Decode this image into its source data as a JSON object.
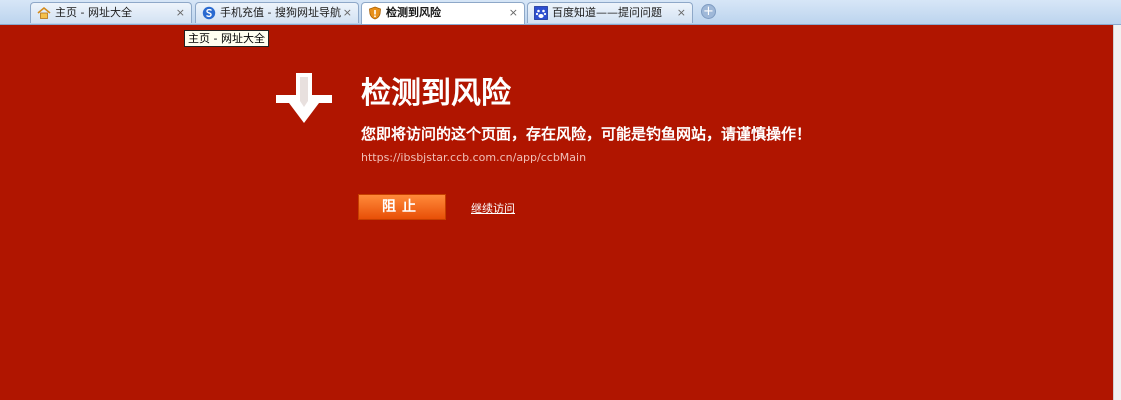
{
  "tabs": [
    {
      "label": "主页 - 网址大全",
      "icon": "home-icon",
      "active": false
    },
    {
      "label": "手机充值 - 搜狗网址导航",
      "icon": "sogou-icon",
      "active": false
    },
    {
      "label": "检测到风险",
      "icon": "shield-warning-icon",
      "active": true
    },
    {
      "label": "百度知道——提问问题",
      "icon": "baidu-paw-icon",
      "active": false
    }
  ],
  "close_glyph": "×",
  "new_tab_glyph": "+",
  "tooltip": "主页 - 网址大全",
  "warning": {
    "title": "检测到风险",
    "message": "您即将访问的这个页面，存在风险，可能是钓鱼网站，请谨慎操作！",
    "url": "https://ibsbjstar.ccb.com.cn/app/ccbMain",
    "block_button": "阻止",
    "continue_link": "继续访问"
  },
  "colors": {
    "page_background": "#b01500",
    "block_button": "#f06a1e",
    "text": "#ffffff"
  }
}
